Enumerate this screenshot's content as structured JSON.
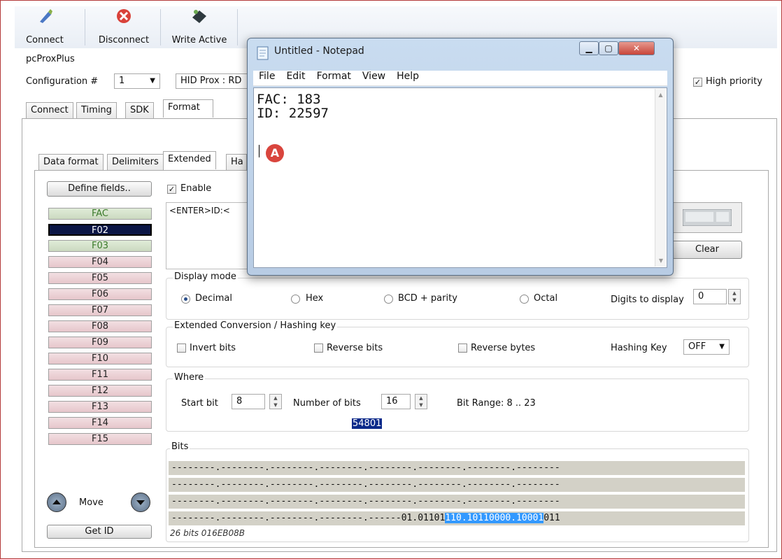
{
  "toolbar": {
    "connect": "Connect",
    "disconnect": "Disconnect",
    "write_active": "Write Active"
  },
  "app": {
    "product": "pcProxPlus",
    "config_label": "Configuration #",
    "config_value": "1",
    "card_type": "HID Prox : RD",
    "high_priority": "High priority"
  },
  "main_tabs": [
    "Connect",
    "Timing",
    "SDK",
    "Format"
  ],
  "sub_tabs": [
    "Data format",
    "Delimiters",
    "Extended",
    "Ha"
  ],
  "fields_panel": {
    "define_fields": "Define fields..",
    "fields": [
      "FAC",
      "F02",
      "F03",
      "F04",
      "F05",
      "F06",
      "F07",
      "F08",
      "F09",
      "F10",
      "F11",
      "F12",
      "F13",
      "F14",
      "F15"
    ],
    "move": "Move",
    "get_id": "Get ID"
  },
  "extended": {
    "enable": "Enable",
    "sequence_text": "<ENTER>ID:<",
    "clear": "Clear"
  },
  "display_mode": {
    "title": "Display mode",
    "options": [
      "Decimal",
      "Hex",
      "BCD + parity",
      "Octal"
    ],
    "selected": "Decimal",
    "digits_label": "Digits to display",
    "digits_value": "0"
  },
  "conversion": {
    "title": "Extended Conversion / Hashing key",
    "invert_bits": "Invert  bits",
    "reverse_bits": "Reverse bits",
    "reverse_bytes": "Reverse bytes",
    "hashing_key_label": "Hashing Key",
    "hashing_key_value": "OFF"
  },
  "where": {
    "title": "Where",
    "start_bit_label": "Start bit",
    "start_bit": "8",
    "num_bits_label": "Number of bits",
    "num_bits": "16",
    "bit_range": "Bit Range: 8 .. 23",
    "value_highlight": "54801"
  },
  "bits": {
    "title": "Bits",
    "rows": [
      "--------.--------.--------.--------.--------.--------.--------.--------",
      "--------.--------.--------.--------.--------.--------.--------.--------",
      "--------.--------.--------.--------.--------.--------.--------.--------"
    ],
    "last_prefix": "--------.--------.--------.--------.------01.01101",
    "last_highlight": "110.10110000.10001",
    "last_suffix": "011",
    "summary": "26 bits 016EB08B"
  },
  "notepad": {
    "title": "Untitled - Notepad",
    "menu": [
      "File",
      "Edit",
      "Format",
      "View",
      "Help"
    ],
    "text_line1": "FAC: 183",
    "text_line2": "ID: 22597",
    "marker": "A"
  },
  "colors": {
    "selected_field": "#0a1545",
    "highlight": "#3399ff",
    "close_button": "#c8453a"
  }
}
